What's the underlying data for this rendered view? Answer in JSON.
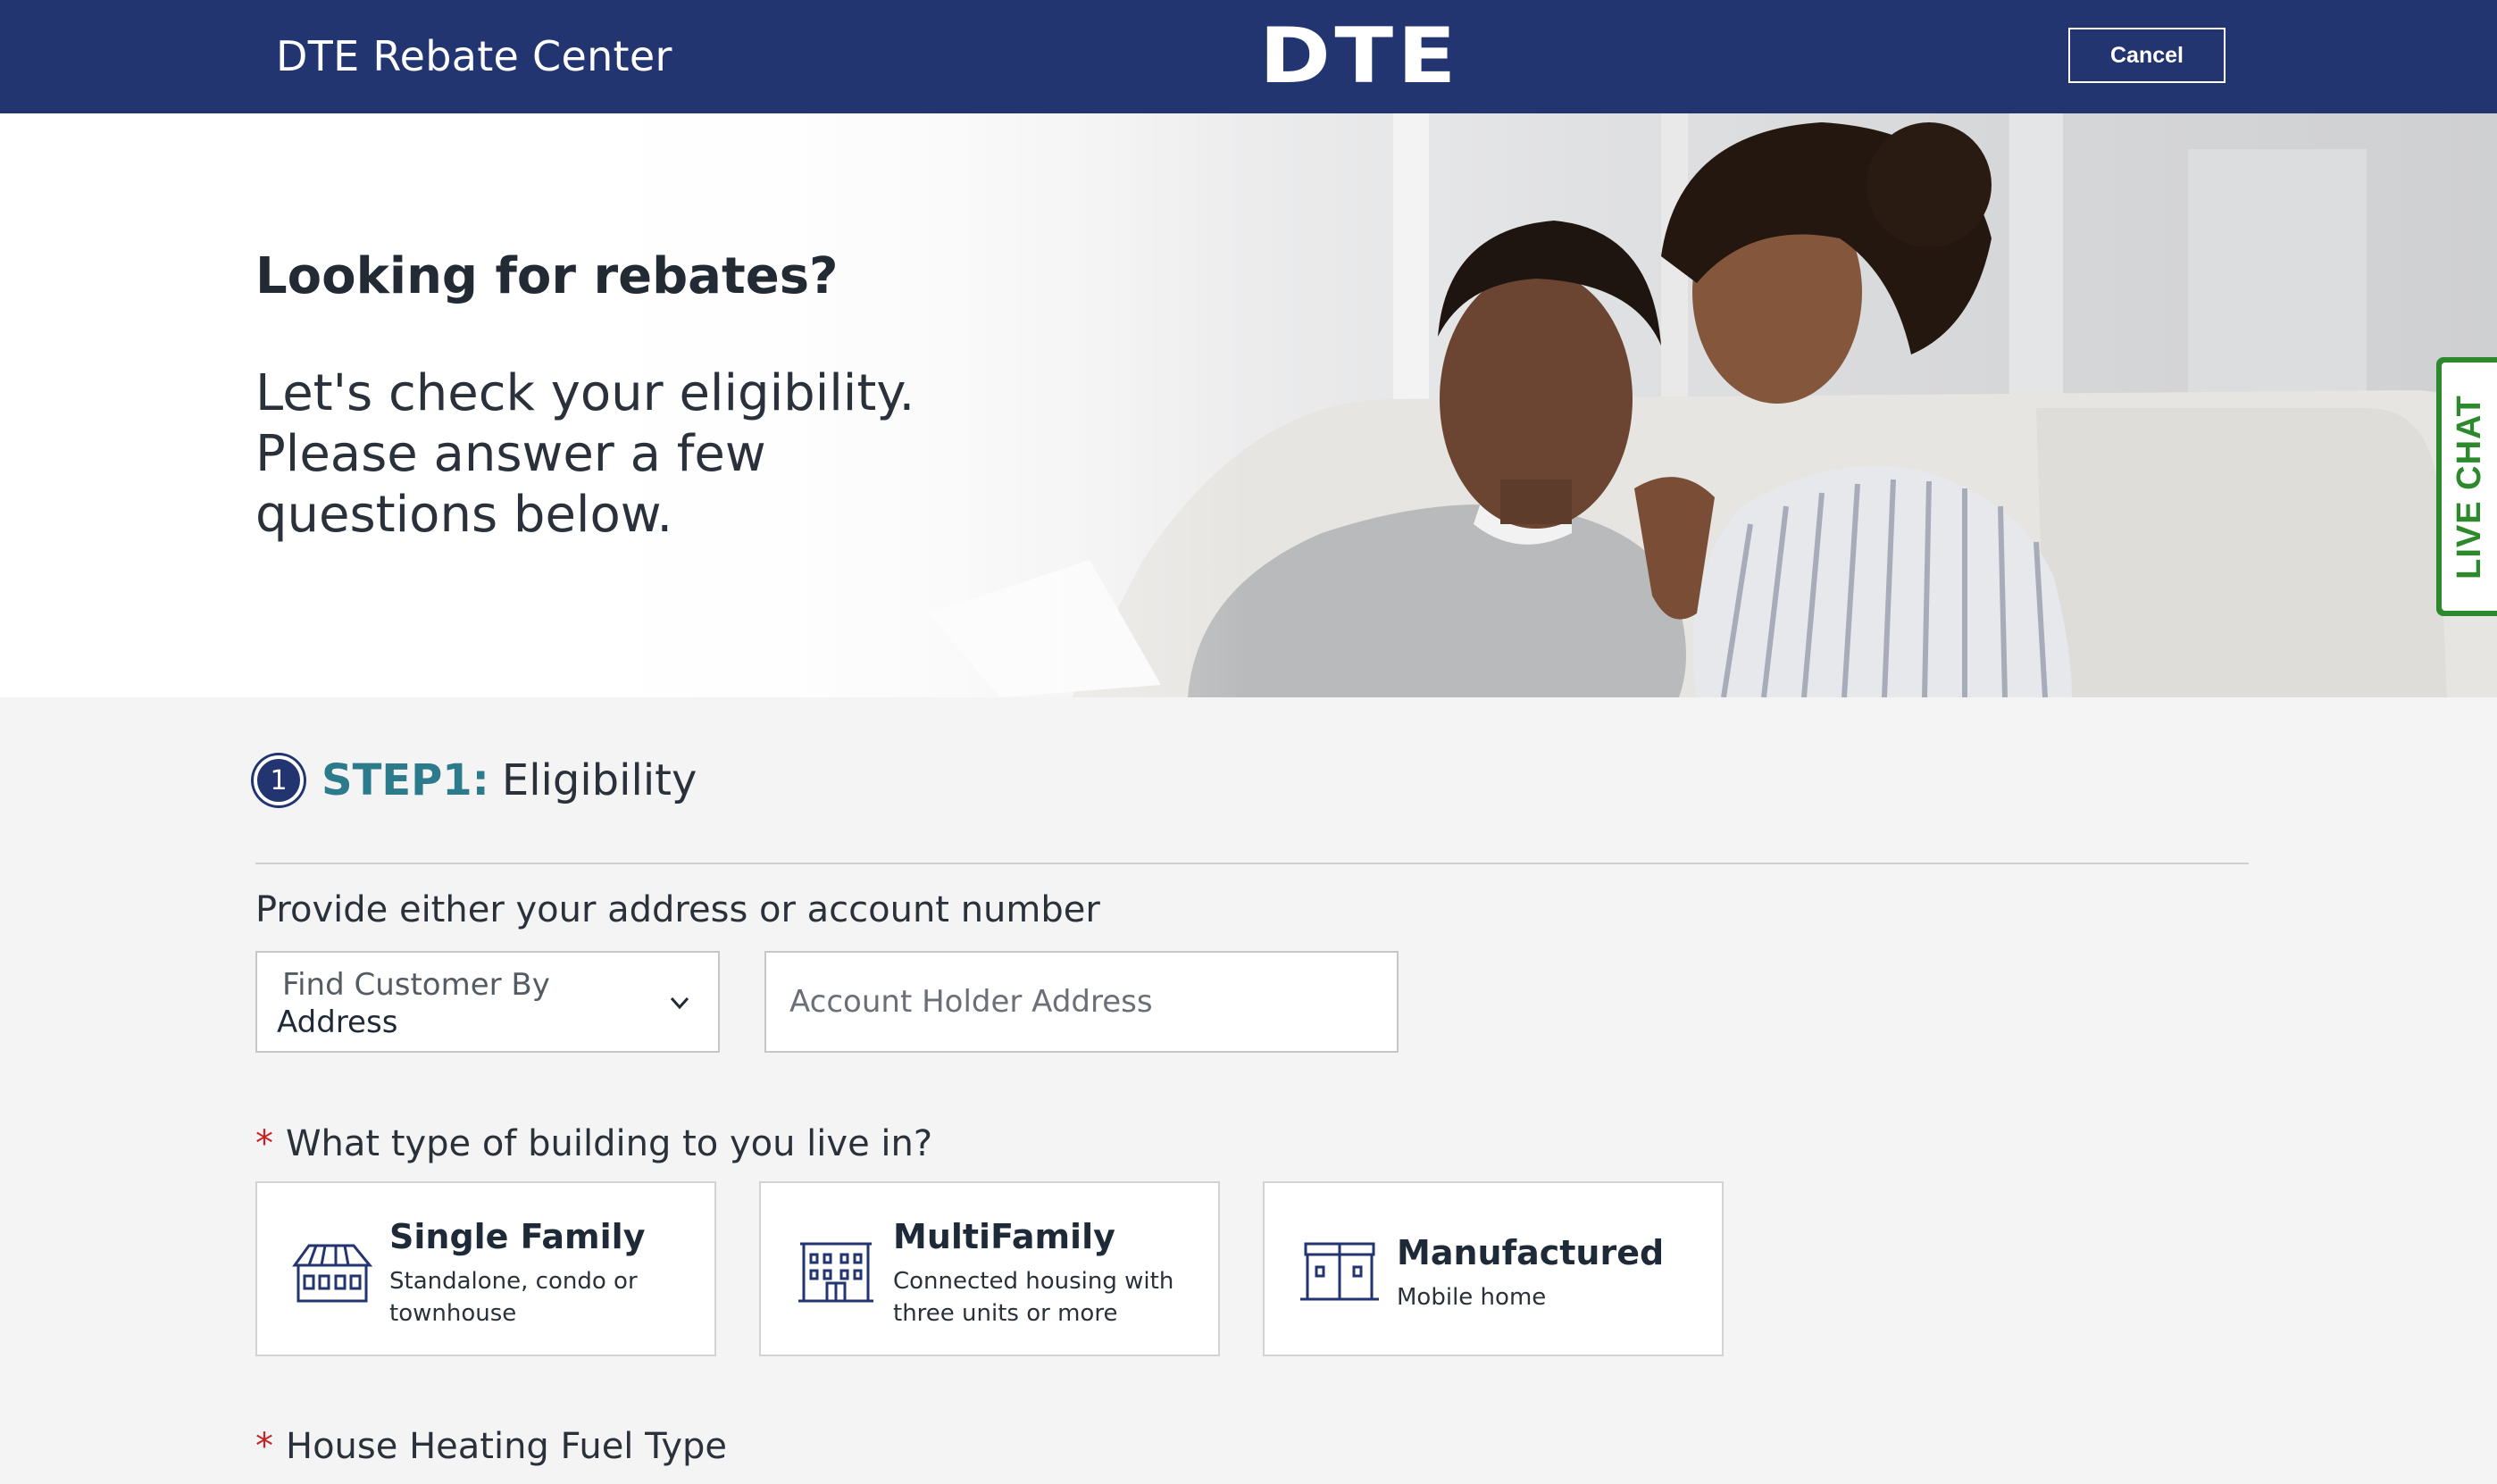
{
  "header": {
    "site_title": "DTE Rebate Center",
    "logo_text": "DTE",
    "cancel_label": "Cancel",
    "background_color": "#223571"
  },
  "hero": {
    "heading": "Looking for rebates?",
    "subheading": "Let's check your eligibility. Please answer a few questions below."
  },
  "live_chat": {
    "label": "LIVE CHAT",
    "color": "#2c8a2c"
  },
  "step": {
    "number": "1",
    "label": "STEP1:",
    "title": "Eligibility"
  },
  "lookup": {
    "prompt": "Provide either your address or account number",
    "select_label": "Find Customer By",
    "select_value": "Address",
    "address_placeholder": "Account Holder Address",
    "address_value": ""
  },
  "building_question": {
    "required_marker": "*",
    "label": "What type of building to you live in?",
    "options": [
      {
        "title": "Single Family",
        "description": "Standalone, condo or townhouse",
        "icon": "single-family-house-icon"
      },
      {
        "title": "MultiFamily",
        "description": "Connected housing with three units or more",
        "icon": "apartment-building-icon"
      },
      {
        "title": "Manufactured",
        "description": "Mobile home",
        "icon": "mobile-home-icon"
      }
    ]
  },
  "heating_question": {
    "required_marker": "*",
    "label": "House Heating Fuel Type"
  }
}
